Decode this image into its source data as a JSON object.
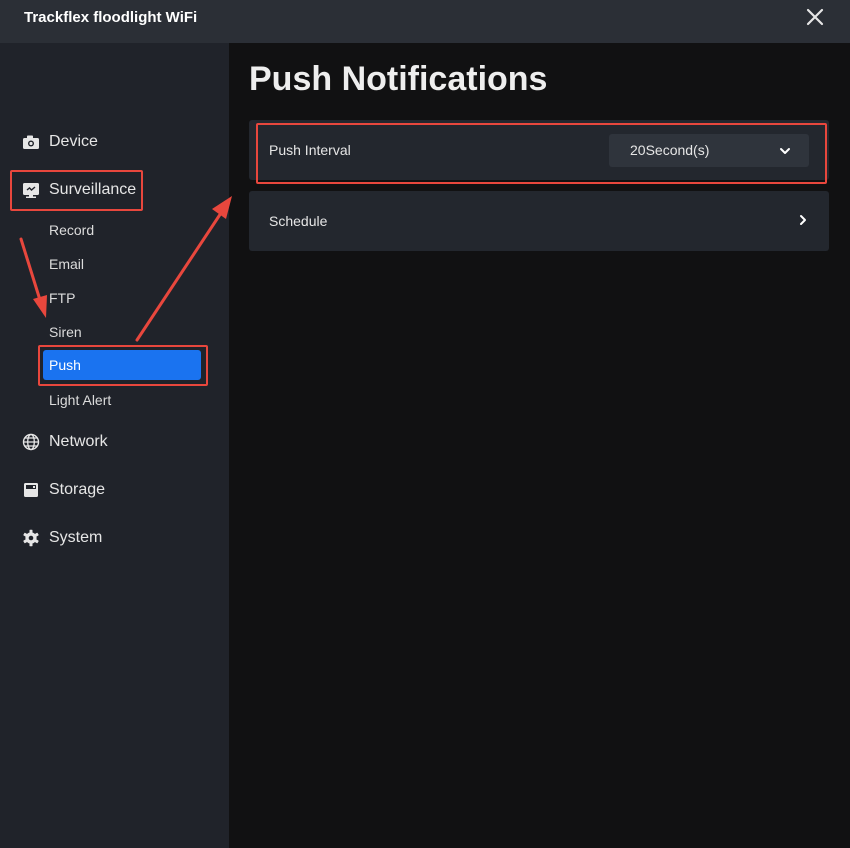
{
  "app": {
    "title": "Trackflex floodlight WiFi",
    "close_icon": "close-icon"
  },
  "sidebar": {
    "items": [
      {
        "label": "Device",
        "icon": "camera-icon"
      },
      {
        "label": "Surveillance",
        "icon": "monitor-icon"
      },
      {
        "label": "Network",
        "icon": "globe-icon"
      },
      {
        "label": "Storage",
        "icon": "storage-icon"
      },
      {
        "label": "System",
        "icon": "gear-icon"
      }
    ],
    "surveillance_sub": [
      "Record",
      "Email",
      "FTP",
      "Siren",
      "Push",
      "Light Alert"
    ],
    "active_sub": "Push"
  },
  "main": {
    "title": "Push Notifications",
    "push_interval": {
      "label": "Push Interval",
      "value": "20Second(s)"
    },
    "schedule": {
      "label": "Schedule"
    }
  },
  "colors": {
    "accent": "#1a73f0",
    "highlight": "#e8473d",
    "sidebar_bg": "#20232a",
    "titlebar_bg": "#2b2f36",
    "content_bg": "#111112",
    "card_bg": "#23272e"
  }
}
